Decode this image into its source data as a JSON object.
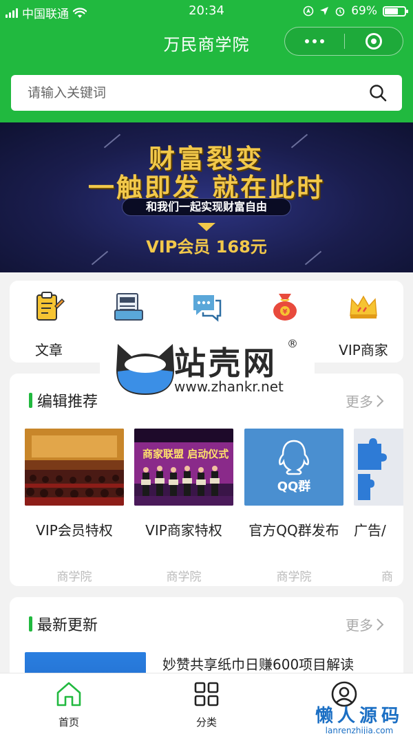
{
  "status_bar": {
    "carrier": "中国联通",
    "time": "20:34",
    "battery_percent": 69,
    "battery_text": "69%"
  },
  "header": {
    "title": "万民商学院"
  },
  "search": {
    "placeholder": "请输入关键词",
    "icon": "search-icon"
  },
  "banner": {
    "line1": "财富裂变",
    "line2": "一触即发 就在此时",
    "line3": "和我们一起实现财富自由",
    "line4": "VIP会员 168元"
  },
  "categories": [
    {
      "label": "文章",
      "icon": "clipboard-icon"
    },
    {
      "label": "",
      "icon": "newspaper-icon"
    },
    {
      "label": "",
      "icon": "chat-icon"
    },
    {
      "label": "",
      "icon": "money-bag-icon"
    },
    {
      "label": "VIP商家",
      "icon": "crown-icon"
    }
  ],
  "recommend": {
    "title": "编辑推荐",
    "more": "更多",
    "items": [
      {
        "title": "VIP会员特权",
        "source": "商学院"
      },
      {
        "title": "VIP商家特权",
        "source": "商学院",
        "image_text": "商家联盟 启动仪式"
      },
      {
        "title": "官方QQ群发布",
        "source": "商学院",
        "image_text": "QQ群"
      },
      {
        "title": "广告/",
        "source": "商"
      }
    ]
  },
  "latest": {
    "title": "最新更新",
    "more": "更多",
    "items": [
      {
        "title": "妙赞共享纸巾日赚600项目解读"
      }
    ]
  },
  "watermark": {
    "brand": "站壳网",
    "reg": "®",
    "url": "www.zhankr.net"
  },
  "tabbar": {
    "items": [
      {
        "label": "首页",
        "icon": "home-icon",
        "active": true
      },
      {
        "label": "分类",
        "icon": "grid-icon",
        "active": false
      },
      {
        "label": "",
        "icon": "user-icon",
        "active": false
      }
    ]
  },
  "corner_watermark": {
    "big": "懒人源码",
    "small": "lanrenzhijia.com"
  },
  "colors": {
    "brand_green": "#21b93f",
    "banner_gold": "#f2c84a",
    "banner_bg": "#161a44"
  }
}
